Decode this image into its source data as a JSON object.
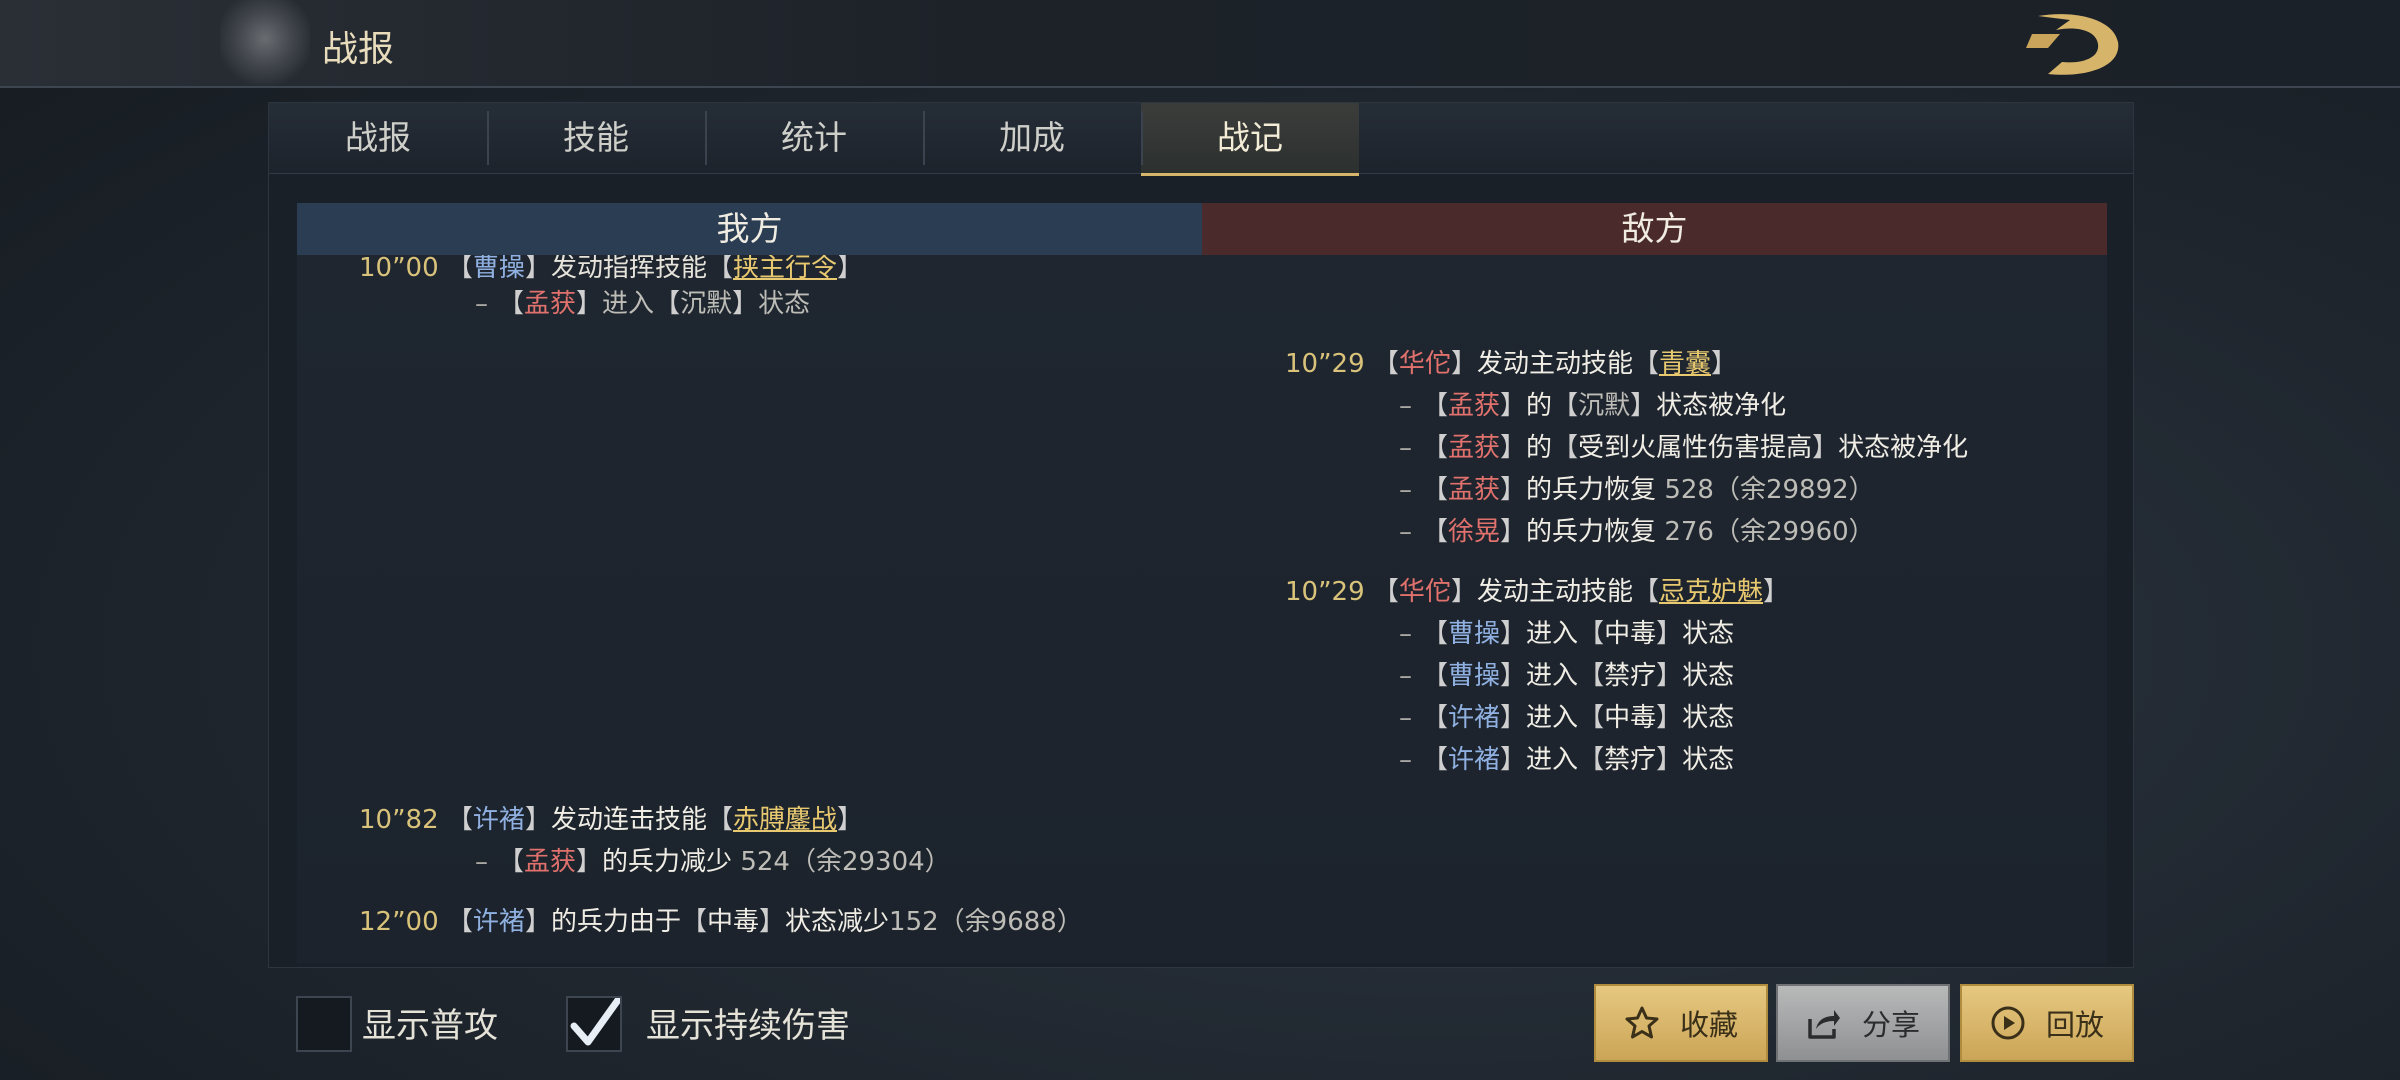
{
  "header": {
    "title": "战报"
  },
  "tabs": [
    {
      "label": "战报"
    },
    {
      "label": "技能"
    },
    {
      "label": "统计"
    },
    {
      "label": "加成"
    },
    {
      "label": "战记",
      "active": true
    }
  ],
  "sides": {
    "mine": "我方",
    "enemy": "敌方"
  },
  "log": {
    "l0": {
      "time": "10”00",
      "actor": "曹操",
      "text": "发动指挥技能",
      "skill": "挟主行令"
    },
    "l1": {
      "target": "孟获",
      "text1": "进入",
      "state": "沉默",
      "text2": "状态"
    },
    "e1": {
      "time": "10”29",
      "actor": "华佗",
      "text": "发动主动技能",
      "skill": "青囊"
    },
    "e1a": {
      "target": "孟获",
      "text1": "的",
      "state": "沉默",
      "text2": "状态被净化"
    },
    "e1b": {
      "target": "孟获",
      "text1": "的",
      "state": "受到火属性伤害提高",
      "text2": "状态被净化"
    },
    "e1c": {
      "target": "孟获",
      "text1": "的兵力恢复",
      "num": "528（余29892）"
    },
    "e1d": {
      "target": "徐晃",
      "text1": "的兵力恢复",
      "num": "276（余29960）"
    },
    "e2": {
      "time": "10”29",
      "actor": "华佗",
      "text": "发动主动技能",
      "skill": "忌克妒魅"
    },
    "e2a": {
      "target": "曹操",
      "text1": "进入",
      "state": "中毒",
      "text2": "状态"
    },
    "e2b": {
      "target": "曹操",
      "text1": "进入",
      "state": "禁疗",
      "text2": "状态"
    },
    "e2c": {
      "target": "许褚",
      "text1": "进入",
      "state": "中毒",
      "text2": "状态"
    },
    "e2d": {
      "target": "许褚",
      "text1": "进入",
      "state": "禁疗",
      "text2": "状态"
    },
    "m2": {
      "time": "10”82",
      "actor": "许褚",
      "text": "发动连击技能",
      "skill": "赤膊鏖战"
    },
    "m2a": {
      "target": "孟获",
      "text1": "的兵力减少",
      "num": "524（余29304）"
    },
    "m3": {
      "time": "12”00",
      "actor": "许褚",
      "text": "的兵力由于",
      "state": "中毒",
      "text2": "状态减少",
      "num": "152（余9688）"
    }
  },
  "footer": {
    "show_normal_attack": {
      "label": "显示普攻",
      "checked": false
    },
    "show_dot": {
      "label": "显示持续伤害",
      "checked": true
    },
    "buttons": {
      "favorite": "收藏",
      "share": "分享",
      "replay": "回放"
    }
  },
  "colors": {
    "accent_gold": "#d6b66a",
    "mine_header": "#2a3d53",
    "enemy_header": "#4b2a2c",
    "red_name": "#e0716c",
    "blue_name": "#8fb0e0"
  }
}
